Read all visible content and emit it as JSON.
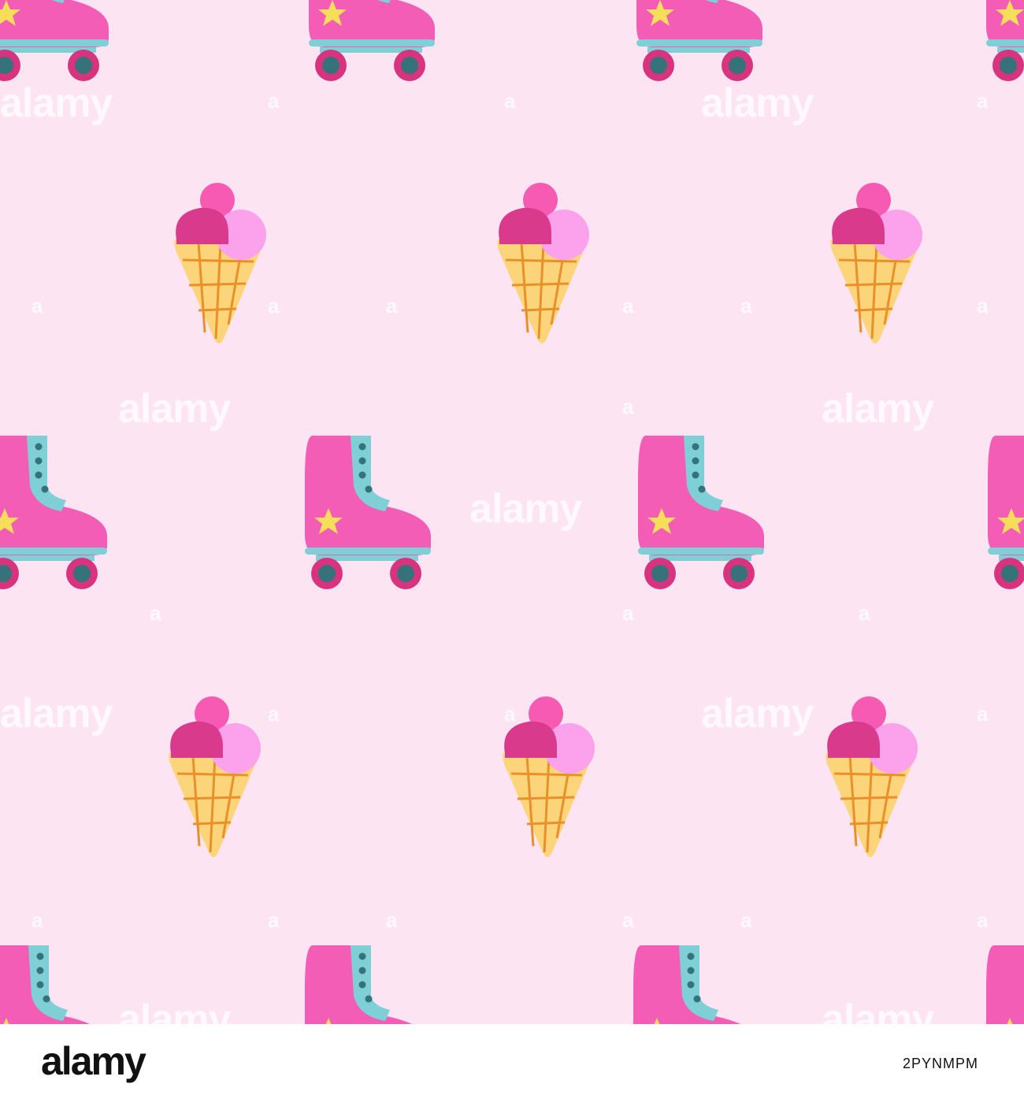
{
  "image": {
    "background_color": "#fde4f3",
    "elements": {
      "roller_skates": "roller-skate-icon",
      "ice_creams": "ice-cream-cone-icon"
    },
    "colors": {
      "skate_pink": "#f35db6",
      "skate_cuff": "#7fcfd6",
      "wheel_rim": "#d8337e",
      "wheel_hub": "#35727a",
      "star": "#f7de5a",
      "scoop_dark": "#d93a8c",
      "scoop_mid": "#f65ab2",
      "scoop_light": "#fca2ec",
      "cone": "#fcd57a",
      "cone_lines": "#e9902a"
    }
  },
  "watermark": {
    "text": "alamy",
    "letter": "a"
  },
  "footer": {
    "logo": "alamy",
    "image_id": "2PYNMPM"
  }
}
